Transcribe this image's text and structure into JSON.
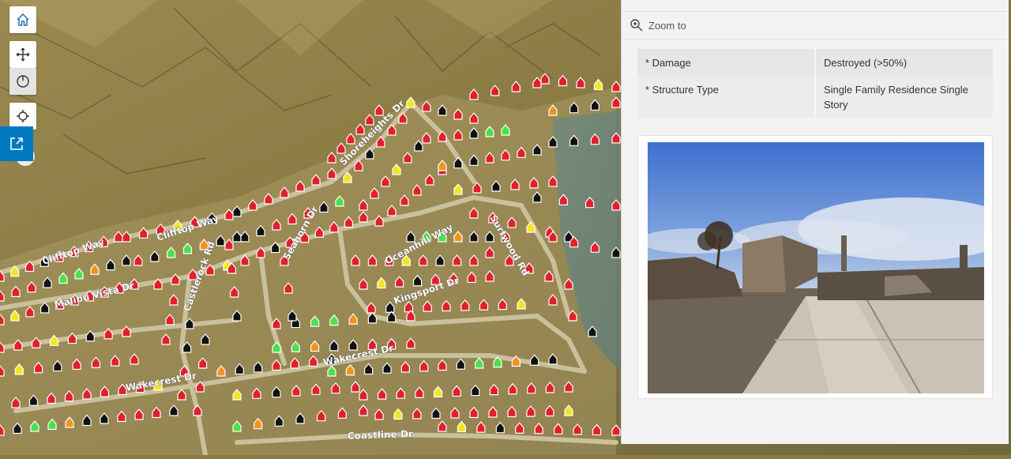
{
  "map": {
    "street_labels": [
      "Clifftop Way",
      "Clifftop Way",
      "Malibu Vista Dr",
      "Castlerock Rd",
      "Seahorn Dr",
      "Oceanhill Way",
      "Kingsport Dr",
      "Wakecrest Dr",
      "Wakecrest Dr",
      "Coastline Dr",
      "Shoreheights Dr",
      "Surfwood Rd"
    ],
    "status_colors": {
      "destroyed": "#e0202a",
      "major": "#f0941e",
      "minor": "#f4e424",
      "affected": "#4ce04a",
      "inaccessible": "#111111"
    },
    "controls": {
      "home": "home-icon",
      "pan": "move-icon",
      "rotate": "compass-icon",
      "locate": "locate-icon",
      "share": "share-icon"
    }
  },
  "popup": {
    "zoom_to_label": "Zoom to",
    "attributes": [
      {
        "key": "* Damage",
        "value": "Destroyed (>50%)"
      },
      {
        "key": "* Structure Type",
        "value": "Single Family Residence Single Story"
      }
    ],
    "photo_description": "burned-structure-photo"
  }
}
